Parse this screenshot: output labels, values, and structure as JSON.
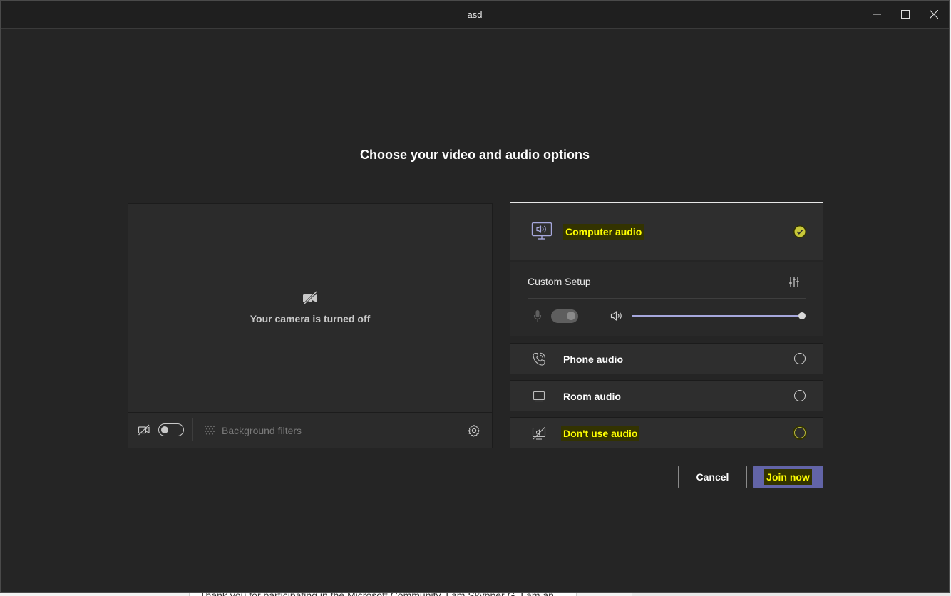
{
  "window": {
    "title": "asd"
  },
  "heading": "Choose your video and audio options",
  "video": {
    "camera_status": "Your camera is turned off",
    "background_filters_label": "Background filters"
  },
  "audio_options": {
    "computer_audio": {
      "label": "Computer audio",
      "selected": true
    },
    "custom_setup": {
      "label": "Custom Setup",
      "volume_fraction": 1.0
    },
    "phone_audio": {
      "label": "Phone audio"
    },
    "room_audio": {
      "label": "Room audio"
    },
    "no_audio": {
      "label": "Don't use audio"
    }
  },
  "actions": {
    "cancel_label": "Cancel",
    "join_label": "Join now"
  },
  "background_page": {
    "snippet": "Thank you for participating in the Microsoft Community. I am Skypper G, I am an"
  },
  "colors": {
    "accent": "#6264a7",
    "highlight": "#ffff00",
    "window_bg": "#252525"
  }
}
